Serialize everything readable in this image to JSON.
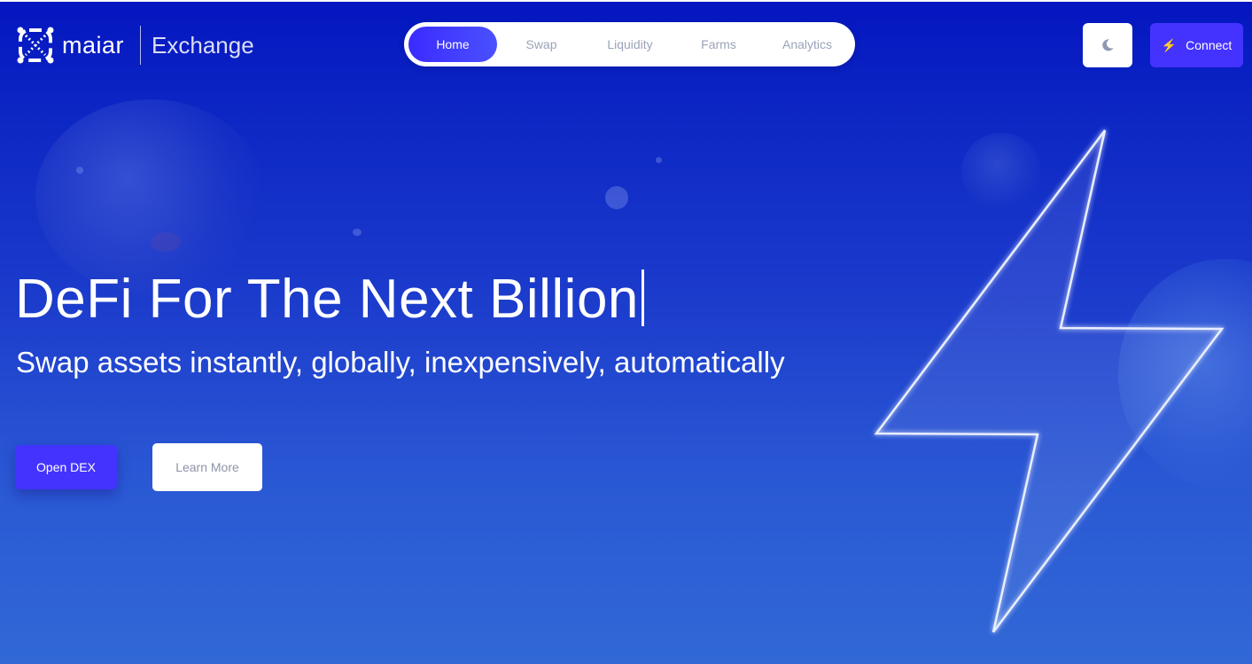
{
  "header": {
    "logo_text": "maiar",
    "logo_subtitle": "Exchange"
  },
  "nav": {
    "items": [
      {
        "label": "Home",
        "active": true
      },
      {
        "label": "Swap",
        "active": false
      },
      {
        "label": "Liquidity",
        "active": false
      },
      {
        "label": "Farms",
        "active": false
      },
      {
        "label": "Analytics",
        "active": false
      }
    ]
  },
  "actions": {
    "theme_icon": "moon-icon",
    "connect_icon": "lightning-icon",
    "connect_label": "Connect"
  },
  "hero": {
    "title": "DeFi For The Next Billion",
    "subtitle": "Swap assets instantly, globally, inexpensively, automatically",
    "primary_button": "Open DEX",
    "secondary_button": "Learn More"
  },
  "colors": {
    "accent": "#4433ff",
    "background_top": "#0416c0",
    "background_bottom": "#3168d6"
  }
}
